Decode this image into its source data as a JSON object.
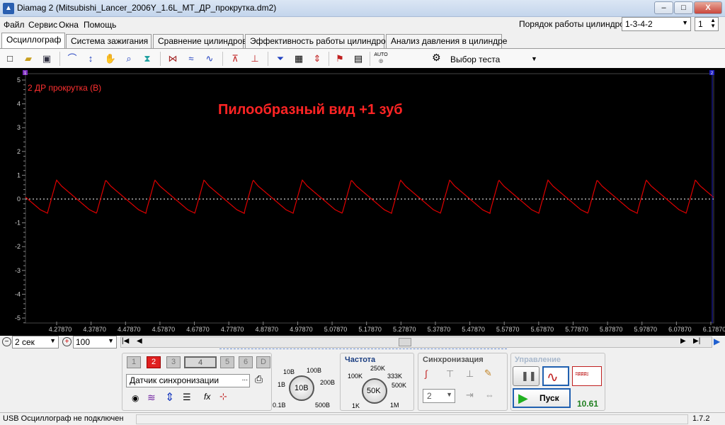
{
  "window": {
    "title": "Diamag 2 (Mitsubishi_Lancer_2006Y_1.6L_MT_ДР_прокрутка.dm2)",
    "min": "–",
    "max": "□",
    "close": "X"
  },
  "menu": [
    "Файл",
    "Сервис",
    "Окна",
    "Помощь"
  ],
  "cylinder_order": {
    "label": "Порядок работы цилиндров",
    "value": "1-3-4-2",
    "count": "1"
  },
  "tabs": [
    "Осциллограф",
    "Система зажигания",
    "Сравнение цилиндров",
    "Эффективность работы цилиндров",
    "Анализ давления в цилиндре"
  ],
  "toolbar": {
    "test_select": "Выбор теста",
    "auto": "AUTO"
  },
  "scope": {
    "channel_label": "2 ДР прокрутка (В)",
    "annotation": "Пилообразный вид +1 зуб",
    "y_ticks": [
      "5",
      "4",
      "3",
      "2",
      "1",
      "0",
      "-1",
      "-2",
      "-3",
      "-4",
      "-5"
    ],
    "x_ticks": [
      "4.27870",
      "4.37870",
      "4.47870",
      "4.57870",
      "4.67870",
      "4.77870",
      "4.87870",
      "4.97870",
      "5.07870",
      "5.17870",
      "5.27870",
      "5.37870",
      "5.47870",
      "5.57870",
      "5.67870",
      "5.77870",
      "5.87870",
      "5.97870",
      "6.07870",
      "6.17870"
    ],
    "marker_left": "1",
    "marker_right": "2",
    "colors": {
      "trace": "#e00000",
      "zero_line": "#ffffff",
      "grid": "#2a2a2a",
      "label": "#ff3030"
    }
  },
  "timebar": {
    "time_value": "2 сек",
    "zoom_value": "100"
  },
  "channels": [
    "1",
    "2",
    "3",
    "4",
    "5",
    "6",
    "D"
  ],
  "sensor": {
    "value": "Датчик синхронизации",
    "more": "..."
  },
  "voltage_knob": {
    "value": "10В",
    "labels": [
      "10В",
      "100В",
      "1В",
      "200В",
      "0.1В",
      "500В"
    ]
  },
  "frequency": {
    "title": "Частота",
    "value": "50K",
    "labels": [
      "250K",
      "100K",
      "333K",
      "500K",
      "1K",
      "1M"
    ]
  },
  "sync": {
    "title": "Синхронизация",
    "channel": "2"
  },
  "control": {
    "title": "Управление",
    "start": "Пуск",
    "counter": "10.61"
  },
  "status": {
    "text": "USB Осциллограф не подключен",
    "version": "1.7.2"
  }
}
